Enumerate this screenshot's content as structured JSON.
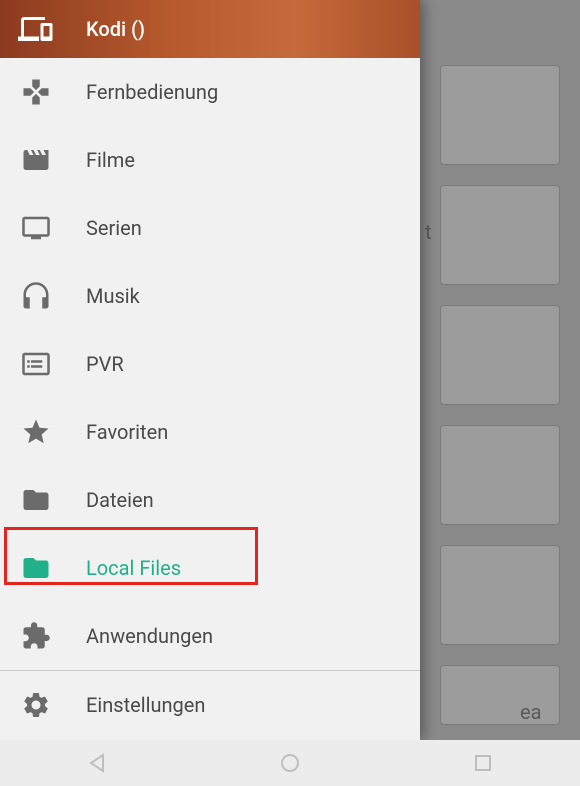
{
  "header": {
    "title": "Kodi ()"
  },
  "menu": {
    "items": [
      {
        "label": "Fernbedienung"
      },
      {
        "label": "Filme"
      },
      {
        "label": "Serien"
      },
      {
        "label": "Musik"
      },
      {
        "label": "PVR"
      },
      {
        "label": "Favoriten"
      },
      {
        "label": "Dateien"
      },
      {
        "label": "Local Files"
      },
      {
        "label": "Anwendungen"
      }
    ],
    "settings_label": "Einstellungen"
  },
  "backdrop": {
    "visible_text_fragments": [
      "t",
      "ea"
    ]
  },
  "colors": {
    "accent": "#20b08a",
    "highlight_border": "#e2261f",
    "header_gradient_start": "#8c3a1f",
    "header_gradient_end": "#a9502a"
  }
}
